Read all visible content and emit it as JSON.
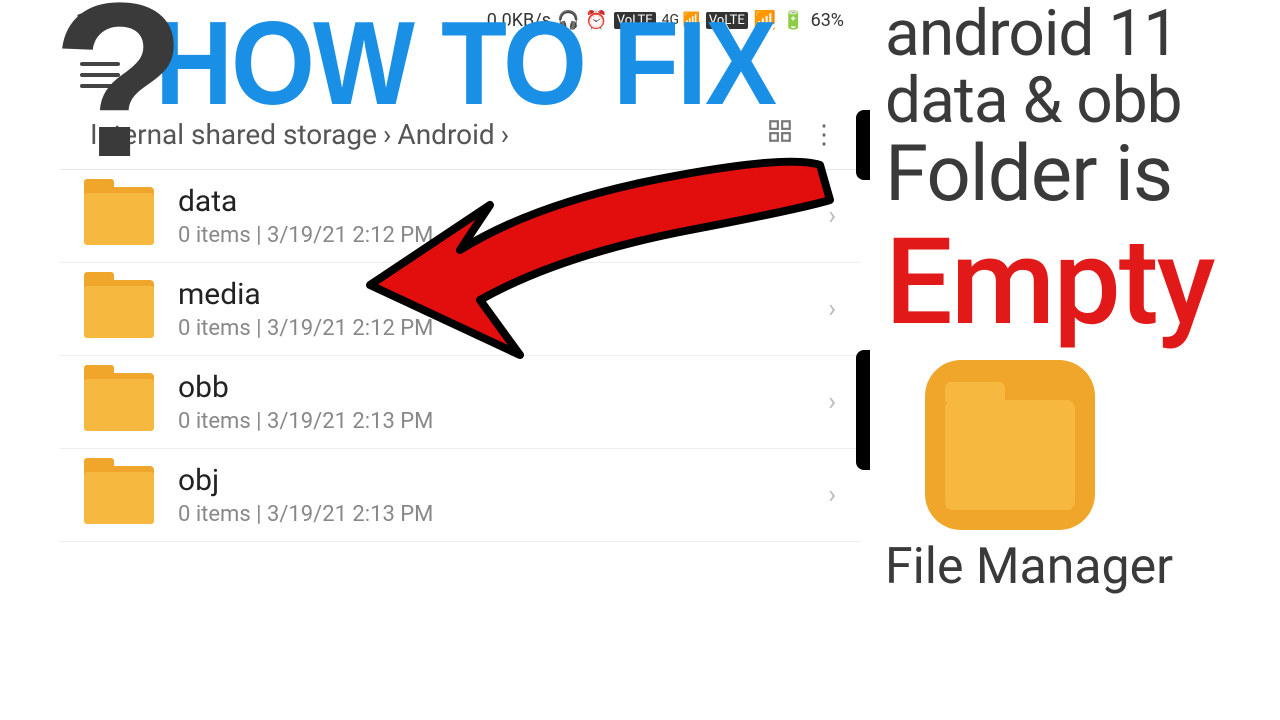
{
  "status": {
    "speed": "0.0KB/s",
    "battery": "63%"
  },
  "breadcrumb": {
    "part1": "Internal shared storage",
    "sep": "›",
    "part2": "Android",
    "sep2": "›"
  },
  "folders": [
    {
      "name": "data",
      "meta": "0 items | 3/19/21 2:12 PM"
    },
    {
      "name": "media",
      "meta": "0 items | 3/19/21 2:12 PM"
    },
    {
      "name": "obb",
      "meta": "0 items | 3/19/21 2:13 PM"
    },
    {
      "name": "obj",
      "meta": "0 items | 3/19/21 2:13 PM"
    }
  ],
  "overlay": {
    "question": "?",
    "headline": "HOW TO FIX"
  },
  "right": {
    "l1": "android 11",
    "l2": "data & obb",
    "l3": "Folder is",
    "empty": "Empty",
    "app": "File Manager"
  }
}
